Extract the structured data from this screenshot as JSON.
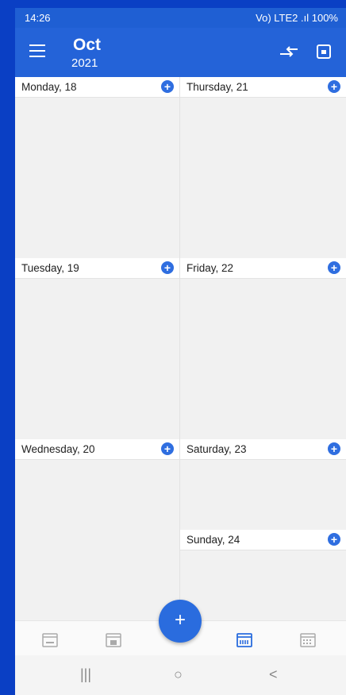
{
  "status_bar": {
    "time": "14:26",
    "right_text": "Vo) LTE2 .ıl 100%"
  },
  "app_bar": {
    "month": "Oct",
    "year": "2021"
  },
  "days": [
    {
      "label": "Monday, 18"
    },
    {
      "label": "Thursday, 21"
    },
    {
      "label": "Tuesday, 19"
    },
    {
      "label": "Friday, 22"
    },
    {
      "label": "Wednesday, 20"
    },
    {
      "label": "Saturday, 23"
    },
    {
      "label": "Sunday, 24"
    }
  ],
  "icons": {
    "menu": "menu-icon",
    "swap": "swap-icon",
    "calendar": "calendar-icon",
    "add": "+",
    "fab": "+"
  },
  "bottom_nav": [
    "day-view-icon",
    "three-day-view-icon",
    "week-view-icon",
    "month-view-icon"
  ],
  "system_nav": {
    "recents": "|||",
    "home": "○",
    "back": "<"
  },
  "colors": {
    "accent": "#2463d8",
    "background": "#0a3fc4",
    "selected_nav": "#2a6cde"
  }
}
